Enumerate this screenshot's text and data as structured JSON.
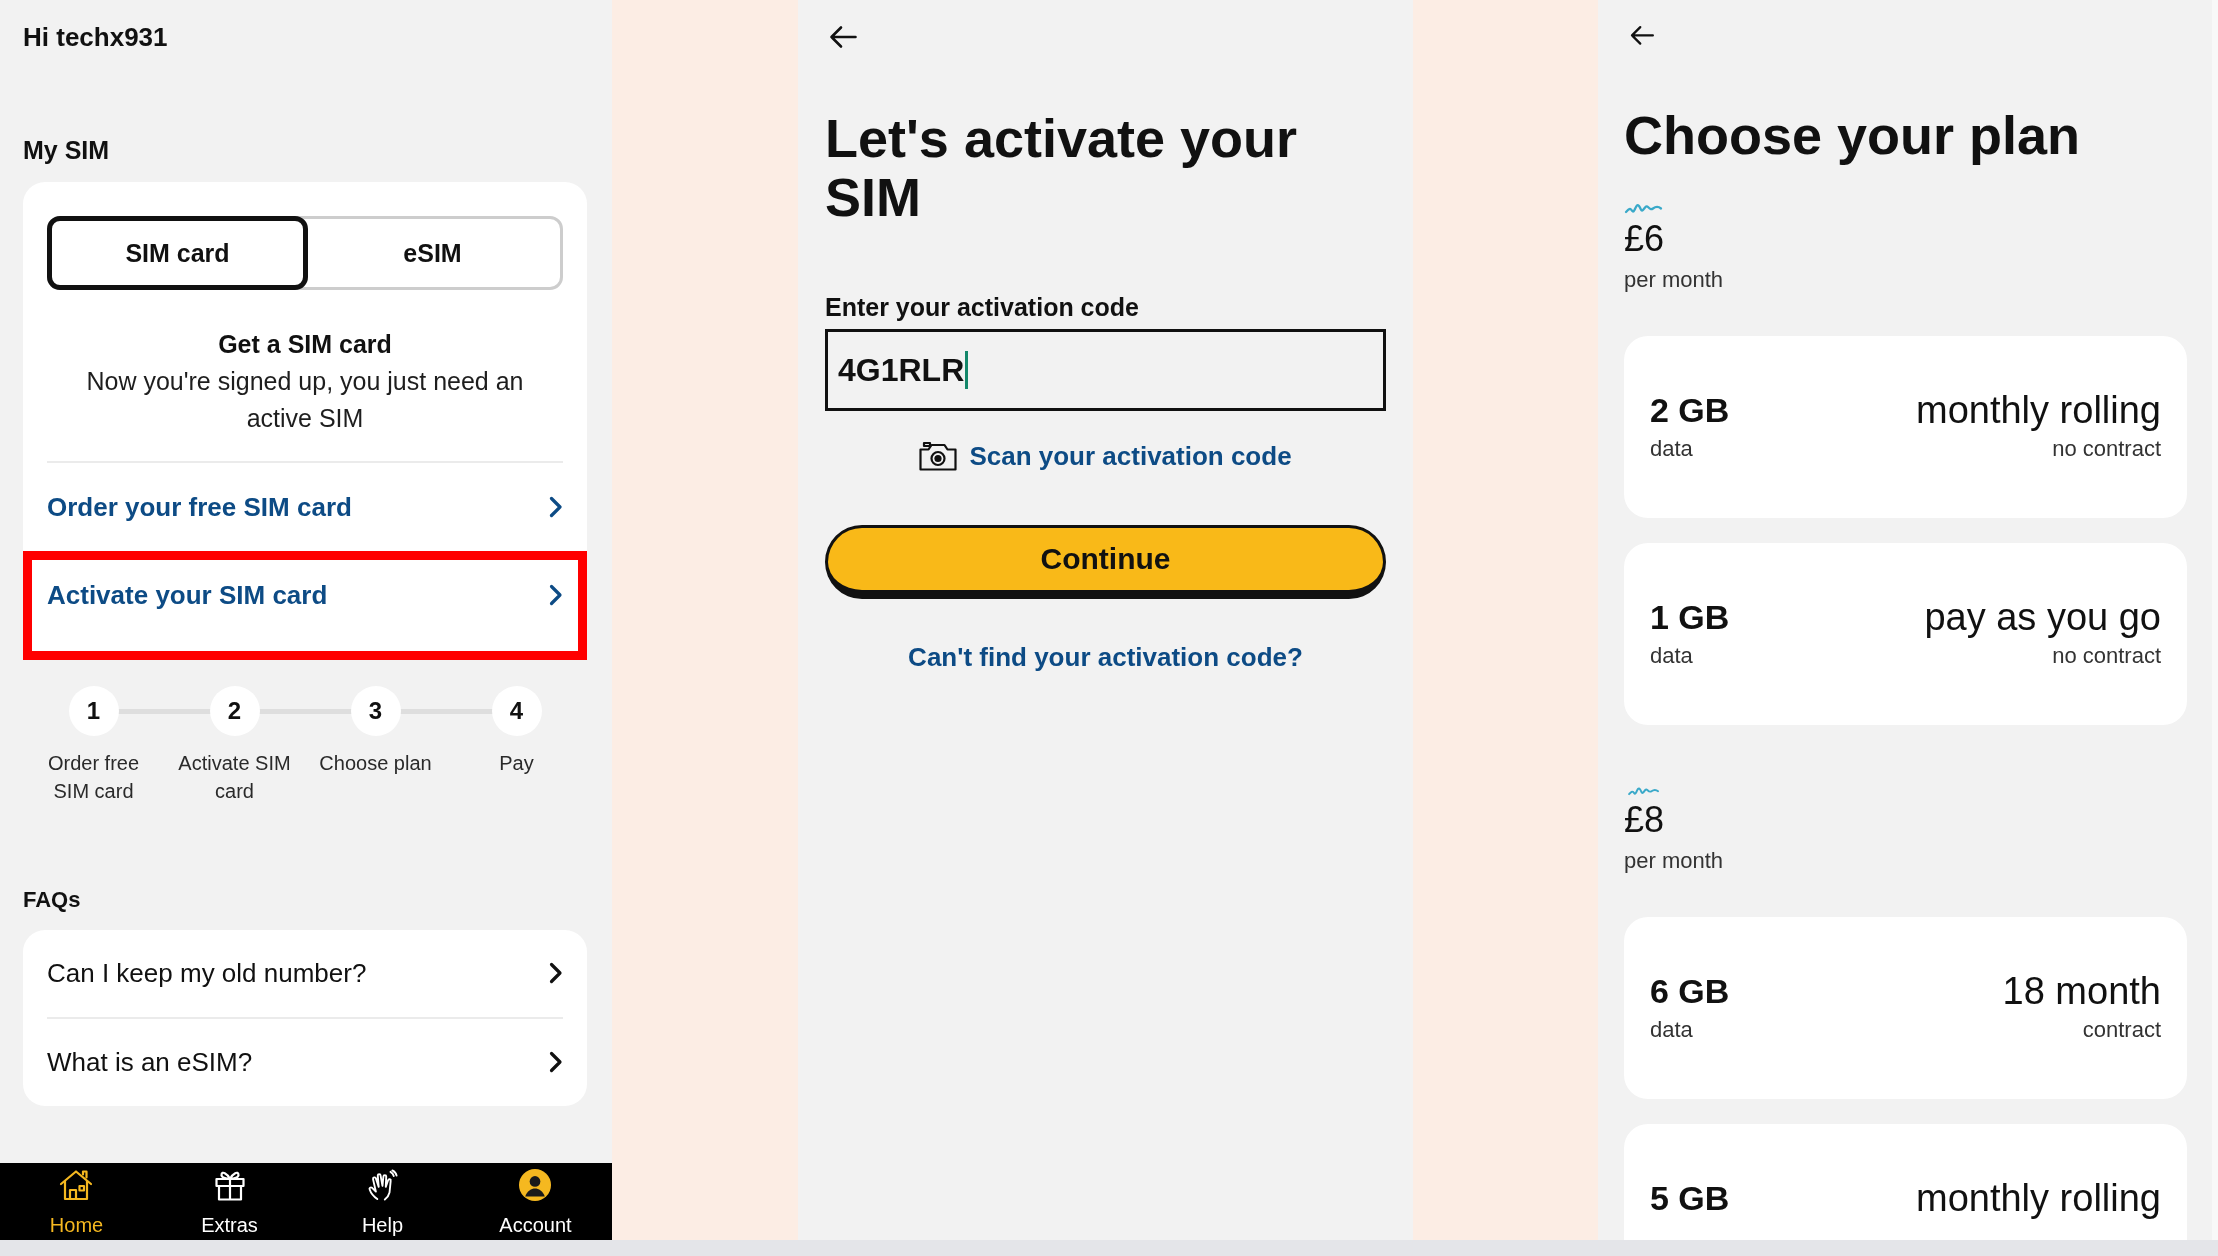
{
  "home_screen": {
    "greeting": "Hi techx931",
    "section_title": "My SIM",
    "sim_tabs": [
      {
        "label": "SIM card",
        "selected": true
      },
      {
        "label": "eSIM",
        "selected": false
      }
    ],
    "info_title": "Get a SIM card",
    "info_text": "Now you're signed up, you just need an active SIM",
    "actions": [
      {
        "label": "Order your free SIM card",
        "highlighted": false
      },
      {
        "label": "Activate your SIM card",
        "highlighted": true
      }
    ],
    "steps": [
      {
        "number": "1",
        "label": "Order free SIM card"
      },
      {
        "number": "2",
        "label": "Activate SIM card"
      },
      {
        "number": "3",
        "label": "Choose plan"
      },
      {
        "number": "4",
        "label": "Pay"
      }
    ],
    "faq_title": "FAQs",
    "faqs": [
      "Can I keep my old number?",
      "What is an eSIM?"
    ],
    "nav": [
      {
        "label": "Home",
        "selected": true
      },
      {
        "label": "Extras",
        "selected": false
      },
      {
        "label": "Help",
        "selected": false
      },
      {
        "label": "Account",
        "selected": false
      }
    ]
  },
  "activation_screen": {
    "title": "Let's activate your SIM",
    "code_field": {
      "label": "Enter your activation code",
      "value": "4G1RLR",
      "focused": true
    },
    "scan_link": "Scan your activation code",
    "continue_button": "Continue",
    "help_link": "Can't find your activation code?"
  },
  "plan_screen": {
    "title": "Choose your plan",
    "price_groups": [
      {
        "price": "£6",
        "period": "per month",
        "plans": [
          {
            "data_amount": "2 GB",
            "data_label": "data",
            "term": "monthly rolling",
            "contract": "no contract"
          },
          {
            "data_amount": "1 GB",
            "data_label": "data",
            "term": "pay as you go",
            "contract": "no contract"
          }
        ]
      },
      {
        "price": "£8",
        "period": "per month",
        "plans": [
          {
            "data_amount": "6 GB",
            "data_label": "data",
            "term": "18 month",
            "contract": "contract"
          },
          {
            "data_amount": "5 GB",
            "term": "monthly rolling"
          }
        ]
      }
    ]
  }
}
